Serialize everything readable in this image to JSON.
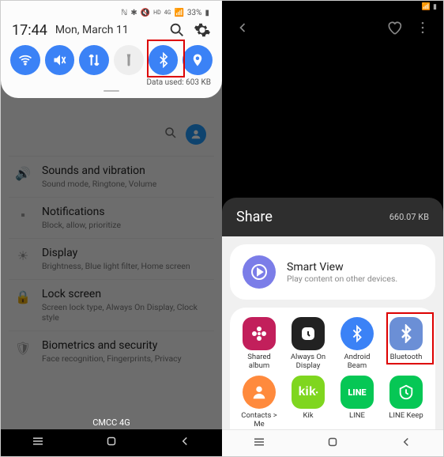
{
  "left": {
    "status": {
      "battery": "33%",
      "net": "4G"
    },
    "time": "17:44",
    "date": "Mon, March 11",
    "data_used": "Data used: 603 KB",
    "carrier": "CMCC 4G",
    "settings": [
      {
        "title": "Sounds and vibration",
        "sub": "Sound mode, Ringtone, Volume"
      },
      {
        "title": "Notifications",
        "sub": "Block, allow, prioritize"
      },
      {
        "title": "Display",
        "sub": "Brightness, Blue light filter, Home screen"
      },
      {
        "title": "Lock screen",
        "sub": "Screen lock type, Always On Display, Clock style"
      },
      {
        "title": "Biometrics and security",
        "sub": "Face recognition, Fingerprints, Privacy"
      }
    ]
  },
  "right": {
    "share_title": "Share",
    "file_size": "660.07 KB",
    "smartview": {
      "title": "Smart View",
      "sub": "Play content on other devices."
    },
    "apps_row1": [
      {
        "label": "Shared album",
        "color": "#c21f5b"
      },
      {
        "label": "Always On Display",
        "color": "#222"
      },
      {
        "label": "Android Beam",
        "color": "#3b82f6"
      },
      {
        "label": "Bluetooth",
        "color": "#6b8fd6"
      }
    ],
    "apps_row2": [
      {
        "label": "Contacts > Me",
        "color": "#ff8a3d"
      },
      {
        "label": "Kik",
        "color": "#7fd61f"
      },
      {
        "label": "LINE",
        "color": "#06c755"
      },
      {
        "label": "LINE Keep",
        "color": "#06c755"
      }
    ]
  }
}
